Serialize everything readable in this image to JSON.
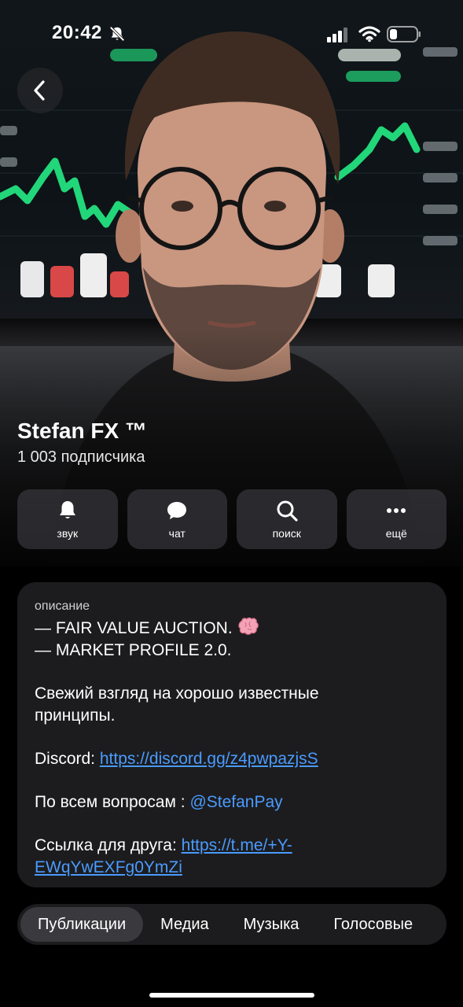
{
  "status_bar": {
    "time": "20:42"
  },
  "channel": {
    "title": "Stefan FX ™",
    "subscribers": "1 003 подписчика"
  },
  "actions": [
    {
      "label": "звук",
      "icon": "bell-icon"
    },
    {
      "label": "чат",
      "icon": "chat-bubble-icon"
    },
    {
      "label": "поиск",
      "icon": "search-icon"
    },
    {
      "label": "ещё",
      "icon": "more-dots-icon"
    }
  ],
  "description": {
    "heading": "описание",
    "line1": "— FAIR VALUE AUCTION.",
    "line2": "— MARKET PROFILE 2.0.",
    "line3a": "Свежий взгляд на хорошо известные",
    "line3b": "принципы.",
    "discord_label": "Discord: ",
    "discord_link": "https://discord.gg/z4pwpazjsS",
    "questions_label": "По всем вопросам : ",
    "questions_mention": "@StefanPay",
    "friend_label": "Ссылка для друга: ",
    "friend_link_a": "https://t.me/+Y-",
    "friend_link_b": "EWqYwEXFg0YmZi"
  },
  "tabs": [
    {
      "label": "Публикации",
      "active": true
    },
    {
      "label": "Медиа",
      "active": false
    },
    {
      "label": "Музыка",
      "active": false
    },
    {
      "label": "Голосовые",
      "active": false
    }
  ],
  "colors": {
    "link": "#4a9bff",
    "card_bg": "#1c1c1e",
    "chart_green": "#22d67a"
  }
}
